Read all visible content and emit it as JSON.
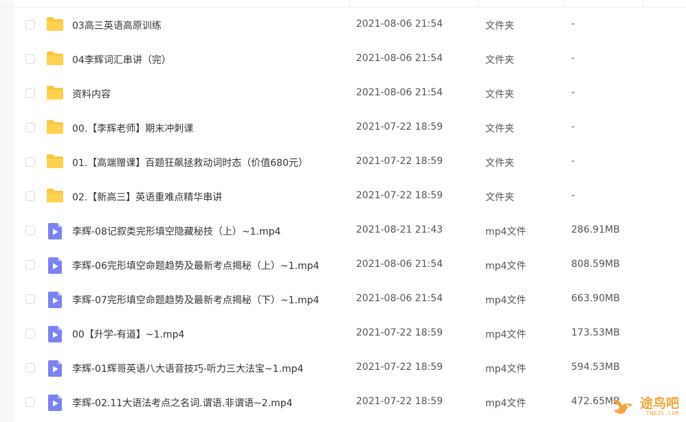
{
  "files": [
    {
      "icon": "folder-icon",
      "name": "03高三英语高原训练",
      "date": "2021-08-06 21:54",
      "type": "文件夹",
      "size": "-"
    },
    {
      "icon": "folder-icon",
      "name": "04李辉词汇串讲（完）",
      "date": "2021-08-06 21:54",
      "type": "文件夹",
      "size": "-"
    },
    {
      "icon": "folder-icon",
      "name": "资料内容",
      "date": "2021-08-06 21:54",
      "type": "文件夹",
      "size": "-"
    },
    {
      "icon": "folder-icon",
      "name": "00.【李辉老师】期末冲刺课",
      "date": "2021-07-22 18:59",
      "type": "文件夹",
      "size": "-"
    },
    {
      "icon": "folder-icon",
      "name": "01.【高端赠课】百题狂飙拯救动词时态（价值680元）",
      "date": "2021-07-22 18:59",
      "type": "文件夹",
      "size": "-"
    },
    {
      "icon": "folder-icon",
      "name": "02.【新高三】英语重难点精华串讲",
      "date": "2021-07-22 18:59",
      "type": "文件夹",
      "size": "-"
    },
    {
      "icon": "video-file-icon",
      "name": "李辉-08记叙类完形填空隐藏秘技（上）~1.mp4",
      "date": "2021-08-21 21:43",
      "type": "mp4文件",
      "size": "286.91MB"
    },
    {
      "icon": "video-file-icon",
      "name": "李辉-06完形填空命题趋势及最新考点揭秘（上）~1.mp4",
      "date": "2021-08-06 21:54",
      "type": "mp4文件",
      "size": "808.59MB"
    },
    {
      "icon": "video-file-icon",
      "name": "李辉-07完形填空命题趋势及最新考点揭秘（下）~1.mp4",
      "date": "2021-08-06 21:54",
      "type": "mp4文件",
      "size": "663.90MB"
    },
    {
      "icon": "video-file-icon",
      "name": "00【升学-有道】~1.mp4",
      "date": "2021-07-22 18:59",
      "type": "mp4文件",
      "size": "173.53MB"
    },
    {
      "icon": "video-file-icon",
      "name": "李辉-01辉哥英语八大语音技巧-听力三大法宝~1.mp4",
      "date": "2021-07-22 18:59",
      "type": "mp4文件",
      "size": "594.53MB"
    },
    {
      "icon": "video-file-icon",
      "name": "李辉-02.11大语法考点之名词.谓语.非谓语~2.mp4",
      "date": "2021-07-22 18:59",
      "type": "mp4文件",
      "size": "472.65MB"
    }
  ],
  "watermark": {
    "text": "途鸟吧",
    "sub": "TNBZS.COM"
  },
  "colors": {
    "folder": "#fcc63f",
    "video": "#7b82f4",
    "watermark": "#f6a43b"
  }
}
